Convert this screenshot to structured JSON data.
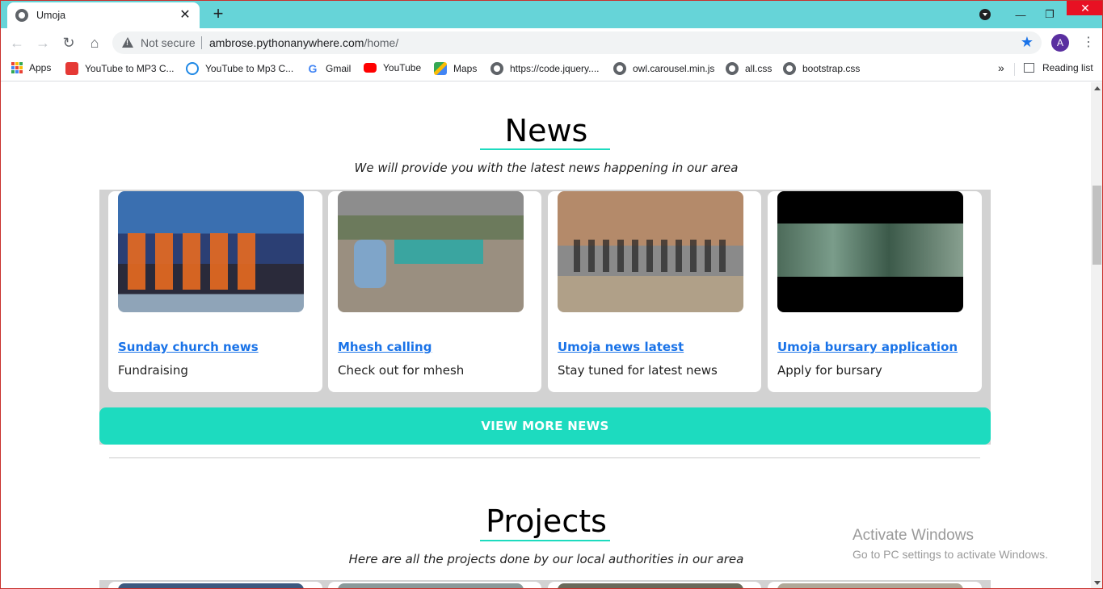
{
  "browser": {
    "tab_title": "Umoja",
    "tab_close": "✕",
    "new_tab": "+",
    "not_secure": "Not secure",
    "url_host": "ambrose.pythonanywhere.com",
    "url_path": "/home/",
    "profile_initial": "A"
  },
  "bookmarks": [
    {
      "label": "Apps",
      "icon": "apps-grid-icon"
    },
    {
      "label": "YouTube to MP3 C...",
      "icon": "download-icon"
    },
    {
      "label": "YouTube to Mp3 C...",
      "icon": "cloud-download-icon"
    },
    {
      "label": "Gmail",
      "icon": "google-icon"
    },
    {
      "label": "YouTube",
      "icon": "youtube-icon"
    },
    {
      "label": "Maps",
      "icon": "maps-icon"
    },
    {
      "label": "https://code.jquery....",
      "icon": "globe-icon"
    },
    {
      "label": "owl.carousel.min.js",
      "icon": "globe-icon"
    },
    {
      "label": "all.css",
      "icon": "globe-icon"
    },
    {
      "label": "bootstrap.css",
      "icon": "globe-icon"
    }
  ],
  "bookmarks_more": "»",
  "reading_list": "Reading list",
  "news": {
    "title": "News",
    "subtitle": "We will provide you with the latest news happening in our area",
    "cards": [
      {
        "title": "Sunday church news",
        "desc": "Fundraising"
      },
      {
        "title": "Mhesh calling",
        "desc": "Check out for mhesh"
      },
      {
        "title": "Umoja news latest",
        "desc": "Stay tuned for latest news"
      },
      {
        "title": "Umoja bursary application",
        "desc": "Apply for bursary"
      }
    ],
    "more_button": "VIEW MORE NEWS"
  },
  "projects": {
    "title": "Projects",
    "subtitle": "Here are all the projects done by our local authorities in our area"
  },
  "watermark": {
    "line1": "Activate Windows",
    "line2": "Go to PC settings to activate Windows."
  },
  "colors": {
    "tabstrip": "#66d4d8",
    "accent": "#1ddbbf",
    "link": "#1a73e8"
  }
}
